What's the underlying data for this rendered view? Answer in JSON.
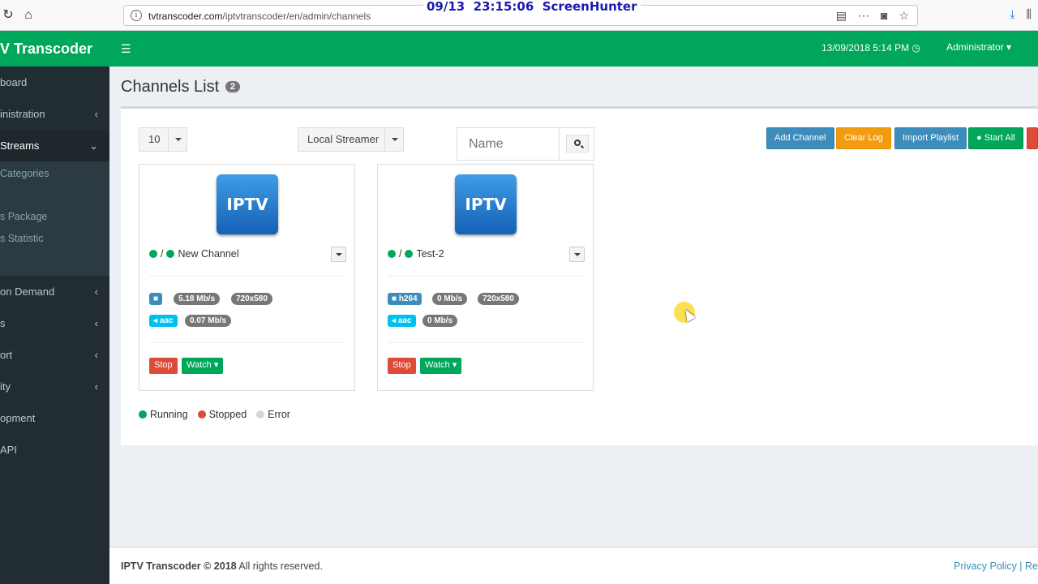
{
  "browser": {
    "url_host": "tvtranscoder.com",
    "url_path": "/iptvtranscoder/en/admin/channels",
    "overlay": "09/13  23:15:06  ScreenHunter"
  },
  "header": {
    "logo": "V Transcoder",
    "datetime": "13/09/2018 5:14 PM",
    "user": "Administrator"
  },
  "sidebar": {
    "items": [
      {
        "label": "board",
        "chevron": ""
      },
      {
        "label": "inistration",
        "chevron": "‹"
      },
      {
        "label": "Streams",
        "chevron": "⌄"
      },
      {
        "label": "on Demand",
        "chevron": "‹"
      },
      {
        "label": "s",
        "chevron": "‹"
      },
      {
        "label": "ort",
        "chevron": "‹"
      },
      {
        "label": "ity",
        "chevron": "‹"
      },
      {
        "label": "opment",
        "chevron": ""
      },
      {
        "label": "API",
        "chevron": ""
      }
    ],
    "sub_items": [
      "Categories",
      "",
      "s Package",
      "s Statistic",
      ""
    ]
  },
  "page": {
    "title": "Channels List",
    "count": "2"
  },
  "toolbar": {
    "page_size": "10",
    "streamer": "Local Streamer",
    "search_placeholder": "Name",
    "add_channel": "Add Channel",
    "clear_log": "Clear Log",
    "import_playlist": "Import Playlist",
    "start_all": "Start All"
  },
  "channels": [
    {
      "logo_text": "IPTV",
      "name": "New Channel",
      "video_codec": "",
      "video_rate": "5.18 Mb/s",
      "resolution": "720x580",
      "audio_codec": "aac",
      "audio_rate": "0.07 Mb/s",
      "stop": "Stop",
      "watch": "Watch"
    },
    {
      "logo_text": "IPTV",
      "name": "Test-2",
      "video_codec": "h264",
      "video_rate": "0 Mb/s",
      "resolution": "720x580",
      "audio_codec": "aac",
      "audio_rate": "0 Mb/s",
      "stop": "Stop",
      "watch": "Watch"
    }
  ],
  "legend": {
    "running": "Running",
    "stopped": "Stopped",
    "error": "Error"
  },
  "footer": {
    "brand": "IPTV Transcoder © 2018",
    "rights": "All rights reserved.",
    "links": "Privacy Policy | Re"
  },
  "colors": {
    "brand_green": "#00a65a",
    "sidebar_bg": "#222d32",
    "primary": "#3c8dbc",
    "warning": "#f39c12",
    "danger": "#dd4b39"
  }
}
